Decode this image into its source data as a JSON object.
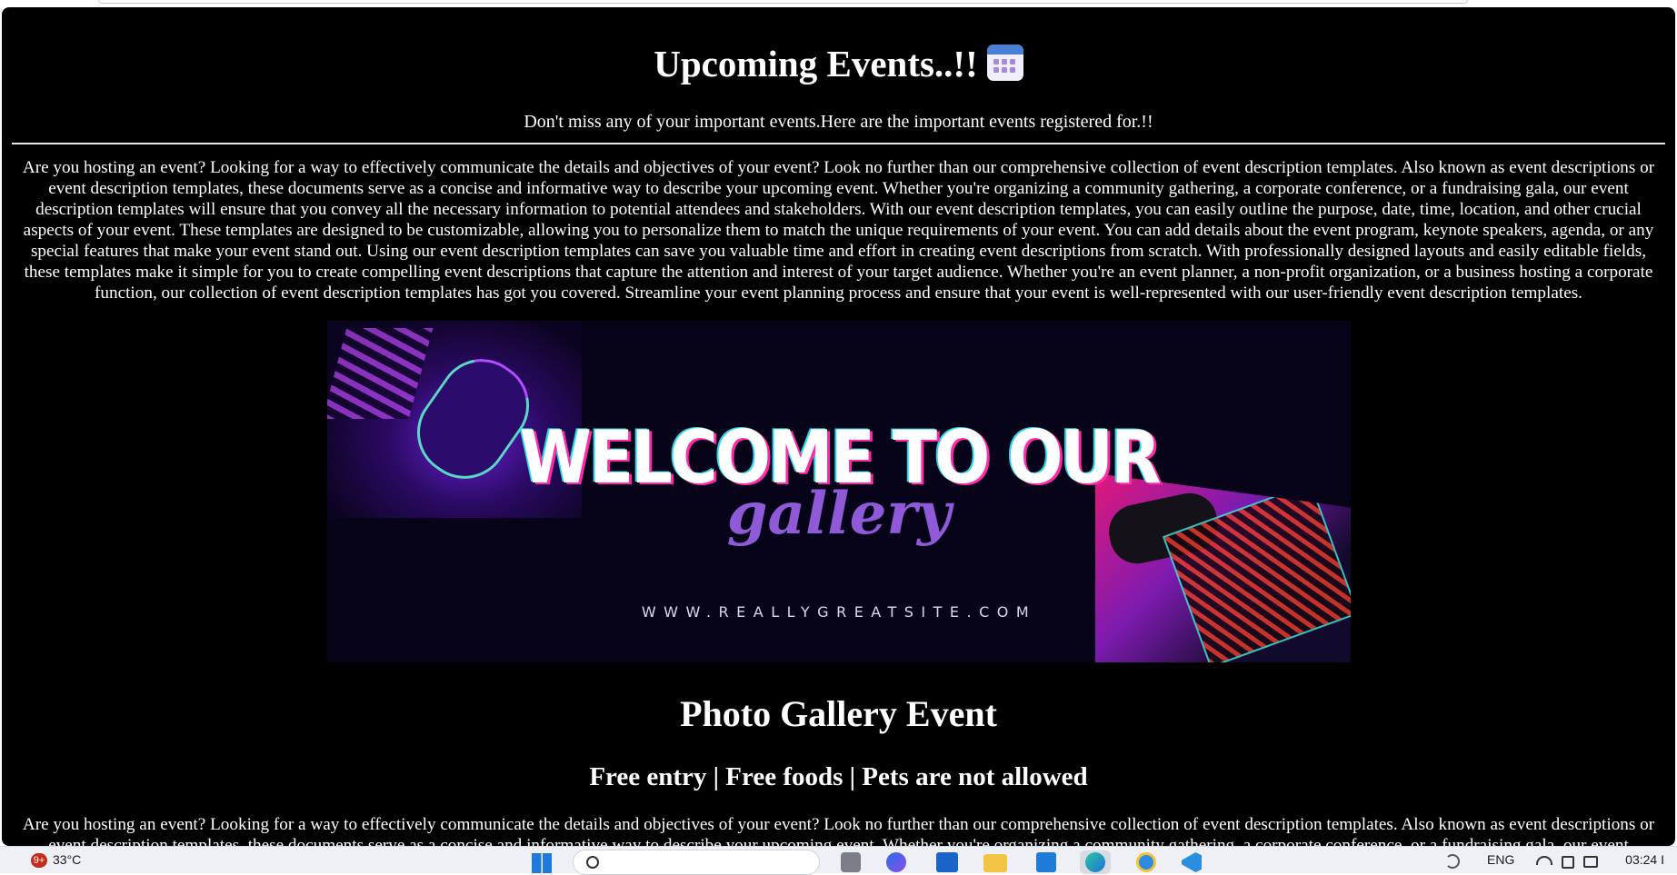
{
  "header": {
    "title": "Upcoming Events..!!",
    "title_icon": "calendar-icon",
    "subtitle": "Don't miss any of your important events.Here are the important events registered for.!!"
  },
  "intro_paragraph": "Are you hosting an event? Looking for a way to effectively communicate the details and objectives of your event? Look no further than our comprehensive collection of event description templates. Also known as event descriptions or event description templates, these documents serve as a concise and informative way to describe your upcoming event. Whether you're organizing a community gathering, a corporate conference, or a fundraising gala, our event description templates will ensure that you convey all the necessary information to potential attendees and stakeholders. With our event description templates, you can easily outline the purpose, date, time, location, and other crucial aspects of your event. These templates are designed to be customizable, allowing you to personalize them to match the unique requirements of your event. You can add details about the event program, keynote speakers, agenda, or any special features that make your event stand out. Using our event description templates can save you valuable time and effort in creating event descriptions from scratch. With professionally designed layouts and easily editable fields, these templates make it simple for you to create compelling event descriptions that capture the attention and interest of your target audience. Whether you're an event planner, a non-profit organization, or a business hosting a corporate function, our collection of event description templates has got you covered. Streamline your event planning process and ensure that your event is well-represented with our user-friendly event description templates.",
  "banner": {
    "headline": "WELCOME TO OUR",
    "script": "gallery",
    "website": "WWW.REALLYGREATSITE.COM"
  },
  "event": {
    "title": "Photo Gallery Event",
    "details": "Free entry | Free foods | Pets are not allowed",
    "description": "Are you hosting an event? Looking for a way to effectively communicate the details and objectives of your event? Look no further than our comprehensive collection of event description templates. Also known as event descriptions or event description templates, these documents serve as a concise and informative way to describe your upcoming event. Whether you're organizing a community gathering, a corporate conference, or a fundraising gala, our event description templates will ensure that you convey all the necessary information to potential attendees and stakeholders."
  },
  "taskbar": {
    "notification_count": "9+",
    "temperature": "33°C",
    "language": "ENG",
    "time": "03:24 I"
  }
}
